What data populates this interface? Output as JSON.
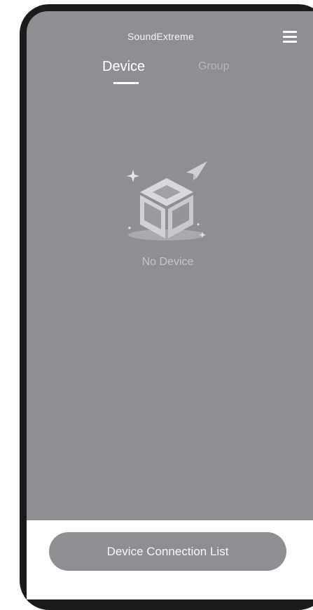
{
  "app": {
    "title": "SoundExtreme"
  },
  "header": {
    "menu_icon": "hamburger-menu-icon"
  },
  "tabs": [
    {
      "label": "Device",
      "active": true
    },
    {
      "label": "Group",
      "active": false
    }
  ],
  "empty_state": {
    "icon": "empty-box-icon",
    "message": "No Device"
  },
  "footer": {
    "button_label": "Device Connection List"
  },
  "colors": {
    "screen_background": "#8e8f93",
    "frame": "#1b1b1b",
    "tab_active": "#ffffff",
    "tab_inactive": "#b6b7bb",
    "footer_background": "#ffffff",
    "button_background": "#8e8f93"
  }
}
